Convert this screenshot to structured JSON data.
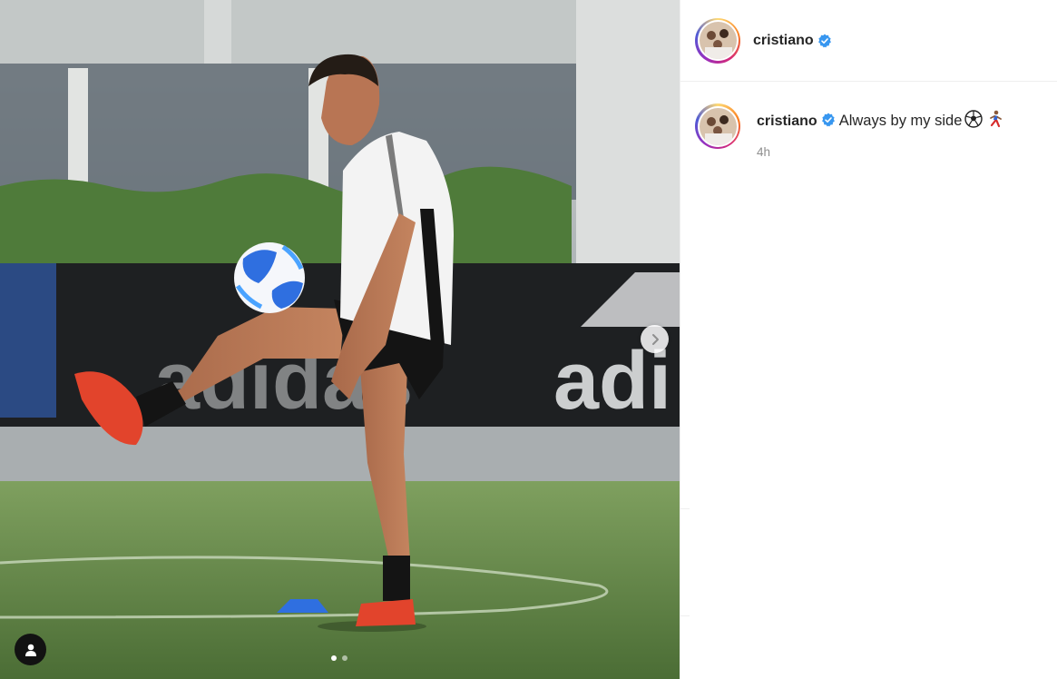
{
  "post": {
    "username": "cristiano",
    "verified": true,
    "caption": "Always by my side",
    "caption_emojis": [
      "soccer-ball-emoji",
      "running-person-emoji"
    ],
    "timestamp": "4h"
  },
  "carousel": {
    "current_slide": 1,
    "total_slides": 2
  },
  "icons": {
    "next": "chevron-right-icon",
    "tags": "person-tag-icon",
    "verified": "verified-badge-icon"
  },
  "colors": {
    "verified_blue": "#3897f0",
    "text": "#262626",
    "muted": "#8e8e8e",
    "divider": "#efefef"
  }
}
